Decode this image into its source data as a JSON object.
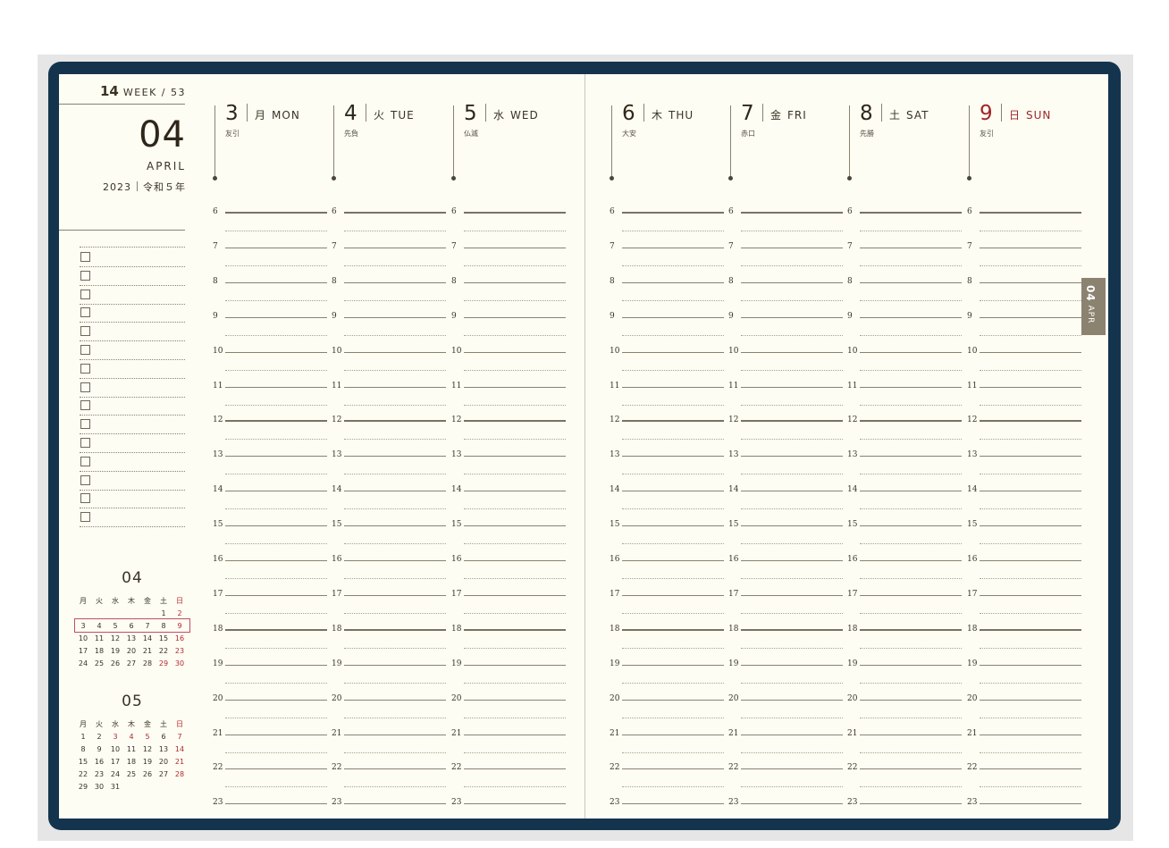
{
  "header": {
    "week_num": "14",
    "week_suffix": "WEEK / 53"
  },
  "month": {
    "number": "04",
    "name": "APRIL",
    "year": "2023",
    "era": "令和５年"
  },
  "todo_count": 15,
  "days": [
    {
      "num": "3",
      "jp": "月",
      "en": "MON",
      "rokuyo": "友引",
      "red": false
    },
    {
      "num": "4",
      "jp": "火",
      "en": "TUE",
      "rokuyo": "先負",
      "red": false
    },
    {
      "num": "5",
      "jp": "水",
      "en": "WED",
      "rokuyo": "仏滅",
      "red": false
    },
    {
      "num": "6",
      "jp": "木",
      "en": "THU",
      "rokuyo": "大安",
      "red": false
    },
    {
      "num": "7",
      "jp": "金",
      "en": "FRI",
      "rokuyo": "赤口",
      "red": false
    },
    {
      "num": "8",
      "jp": "土",
      "en": "SAT",
      "rokuyo": "先勝",
      "red": false
    },
    {
      "num": "9",
      "jp": "日",
      "en": "SUN",
      "rokuyo": "友引",
      "red": true
    }
  ],
  "hours": [
    "6",
    "7",
    "8",
    "9",
    "10",
    "11",
    "12",
    "13",
    "14",
    "15",
    "16",
    "17",
    "18",
    "19",
    "20",
    "21",
    "22",
    "23"
  ],
  "bold_hours": [
    "6",
    "12",
    "18"
  ],
  "mini_calendars": [
    {
      "title": "04",
      "weekdays": [
        "月",
        "火",
        "水",
        "木",
        "金",
        "土",
        "日"
      ],
      "weeks": [
        [
          "",
          "",
          "",
          "",
          "",
          "1",
          "2"
        ],
        [
          "3",
          "4",
          "5",
          "6",
          "7",
          "8",
          "9"
        ],
        [
          "10",
          "11",
          "12",
          "13",
          "14",
          "15",
          "16"
        ],
        [
          "17",
          "18",
          "19",
          "20",
          "21",
          "22",
          "23"
        ],
        [
          "24",
          "25",
          "26",
          "27",
          "28",
          "29",
          "30"
        ]
      ],
      "highlight_week": 1,
      "red_days": [
        "2",
        "9",
        "16",
        "23",
        "29",
        "30"
      ]
    },
    {
      "title": "05",
      "weekdays": [
        "月",
        "火",
        "水",
        "木",
        "金",
        "土",
        "日"
      ],
      "weeks": [
        [
          "1",
          "2",
          "3",
          "4",
          "5",
          "6",
          "7"
        ],
        [
          "8",
          "9",
          "10",
          "11",
          "12",
          "13",
          "14"
        ],
        [
          "15",
          "16",
          "17",
          "18",
          "19",
          "20",
          "21"
        ],
        [
          "22",
          "23",
          "24",
          "25",
          "26",
          "27",
          "28"
        ],
        [
          "29",
          "30",
          "31",
          "",
          "",
          "",
          ""
        ]
      ],
      "highlight_week": -1,
      "red_days": [
        "3",
        "4",
        "5",
        "7",
        "14",
        "21",
        "28"
      ]
    }
  ],
  "side_tab": {
    "num": "04",
    "label": "APR"
  },
  "colors": {
    "cover": "#14344e",
    "paper": "#fdfdf4",
    "accent_red": "#a02626",
    "tab": "#8b8270"
  }
}
